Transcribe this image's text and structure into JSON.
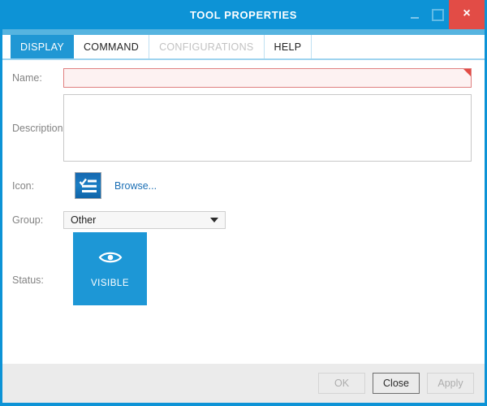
{
  "window": {
    "title": "TOOL PROPERTIES",
    "controls": {
      "minimize": "minimize",
      "maximize": "maximize",
      "close": "×"
    },
    "accent_color": "#0d93d6",
    "close_color": "#e24c46"
  },
  "tabs": [
    {
      "label": "DISPLAY",
      "state": "active"
    },
    {
      "label": "COMMAND",
      "state": "normal"
    },
    {
      "label": "CONFIGURATIONS",
      "state": "disabled"
    },
    {
      "label": "HELP",
      "state": "normal"
    }
  ],
  "form": {
    "name": {
      "label": "Name:",
      "value": "",
      "placeholder": "",
      "invalid": true
    },
    "description": {
      "label": "Description:",
      "value": "",
      "placeholder": ""
    },
    "icon": {
      "label": "Icon:",
      "icon_name": "checklist-icon",
      "browse_label": "Browse..."
    },
    "group": {
      "label": "Group:",
      "selected": "Other",
      "options": [
        "Other"
      ]
    },
    "status": {
      "label": "Status:",
      "value": "VISIBLE",
      "icon_name": "eye-icon",
      "tile_color": "#1d97d6"
    }
  },
  "footer": {
    "buttons": [
      {
        "label": "OK",
        "state": "disabled"
      },
      {
        "label": "Close",
        "state": "primary"
      },
      {
        "label": "Apply",
        "state": "disabled"
      }
    ]
  }
}
